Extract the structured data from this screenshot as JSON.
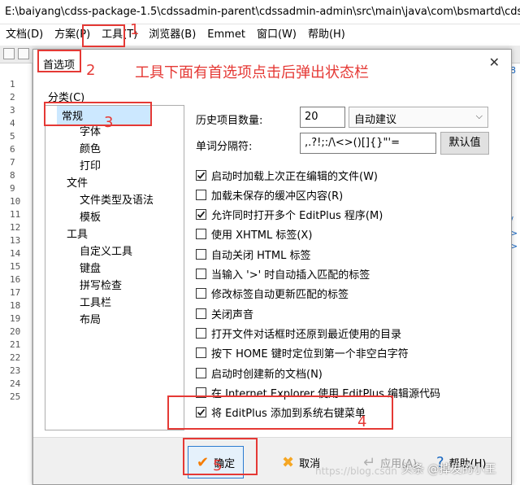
{
  "window": {
    "path": "E:\\baiyang\\cdss-package-1.5\\cdssadmin-parent\\cdssadmin-admin\\src\\main\\java\\com\\bsmartd\\cdss\\adm"
  },
  "menu": [
    "文档(D)",
    "方案(P)",
    "工具(T)",
    "浏览器(B)",
    "Emmet",
    "窗口(W)",
    "帮助(H)"
  ],
  "gutter": [
    "1",
    "2",
    "3",
    "4",
    "5",
    "6",
    "7",
    "8",
    "9",
    "10",
    "11",
    "12",
    "13",
    "14",
    "15",
    "16",
    "17",
    "18",
    "19",
    "20",
    "21",
    "22",
    "23",
    "24",
    "25"
  ],
  "dialog": {
    "title": "首选项",
    "hint": "工具下面有首选项点击后弹出状态栏",
    "category_label": "分类(C)",
    "tree": [
      {
        "label": "常规",
        "level": 1,
        "selected": true
      },
      {
        "label": "字体",
        "level": 2
      },
      {
        "label": "颜色",
        "level": 2
      },
      {
        "label": "打印",
        "level": 2
      },
      {
        "label": "文件",
        "level": 1
      },
      {
        "label": "文件类型及语法",
        "level": 2
      },
      {
        "label": "模板",
        "level": 2
      },
      {
        "label": "工具",
        "level": 1
      },
      {
        "label": "自定义工具",
        "level": 2
      },
      {
        "label": "键盘",
        "level": 2
      },
      {
        "label": "拼写检查",
        "level": 2
      },
      {
        "label": "工具栏",
        "level": 2
      },
      {
        "label": "布局",
        "level": 2
      }
    ],
    "history_label": "历史项目数量:",
    "history_value": "20",
    "history_mode": "自动建议",
    "word_sep_label": "单词分隔符:",
    "word_sep_value": ",.?!;:/\\<>()[]{}\"'=",
    "default_button": "默认值",
    "options": [
      {
        "label": "启动时加载上次正在编辑的文件(W)",
        "checked": true
      },
      {
        "label": "加载未保存的缓冲区内容(R)",
        "checked": false
      },
      {
        "label": "允许同时打开多个 EditPlus 程序(M)",
        "checked": true
      },
      {
        "label": "使用 XHTML 标签(X)",
        "checked": false
      },
      {
        "label": "自动关闭 HTML 标签",
        "checked": false
      },
      {
        "label": "当输入 '>' 时自动插入匹配的标签",
        "checked": false
      },
      {
        "label": "修改标签自动更新匹配的标签",
        "checked": false
      },
      {
        "label": "关闭声音",
        "checked": false
      },
      {
        "label": "打开文件对话框时还原到最近使用的目录",
        "checked": false
      },
      {
        "label": "按下 HOME 键时定位到第一个非空白字符",
        "checked": false
      },
      {
        "label": "启动时创建新的文档(N)",
        "checked": false
      },
      {
        "label": "在 Internet Explorer 使用 EditPlus 编辑源代码",
        "checked": false
      },
      {
        "label": "将 EditPlus 添加到系统右键菜单",
        "checked": true
      }
    ],
    "buttons": {
      "ok": "确定",
      "cancel": "取消",
      "apply": "应用(A)",
      "help": "帮助(H)"
    }
  },
  "annotations": [
    "1",
    "2",
    "3",
    "4",
    "5"
  ],
  "watermarks": {
    "url": "https://blog.csdn",
    "author": "头条 @掉发的小王"
  },
  "colors": {
    "annotation": "#e53935",
    "selection": "#cce8ff",
    "primary_border": "#2b7bd1",
    "check": "#1a1a1a"
  }
}
